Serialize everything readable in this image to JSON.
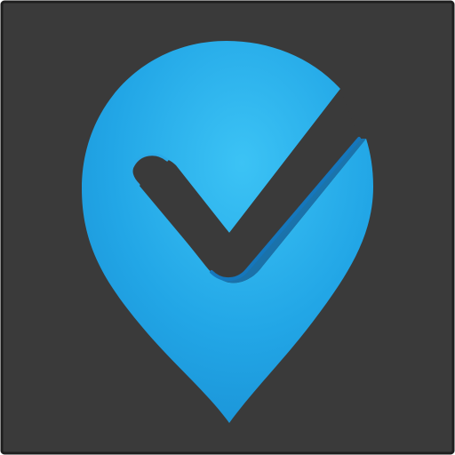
{
  "icon": {
    "name": "location-check-pin",
    "background_color": "#3a3a3a",
    "border_color": "#1e1e1e",
    "pin_color_light": "#3cc3f5",
    "pin_color_mid": "#22a6e6",
    "pin_color_dark": "#137fc4",
    "check_cutout_color": "#3a3a3a"
  }
}
